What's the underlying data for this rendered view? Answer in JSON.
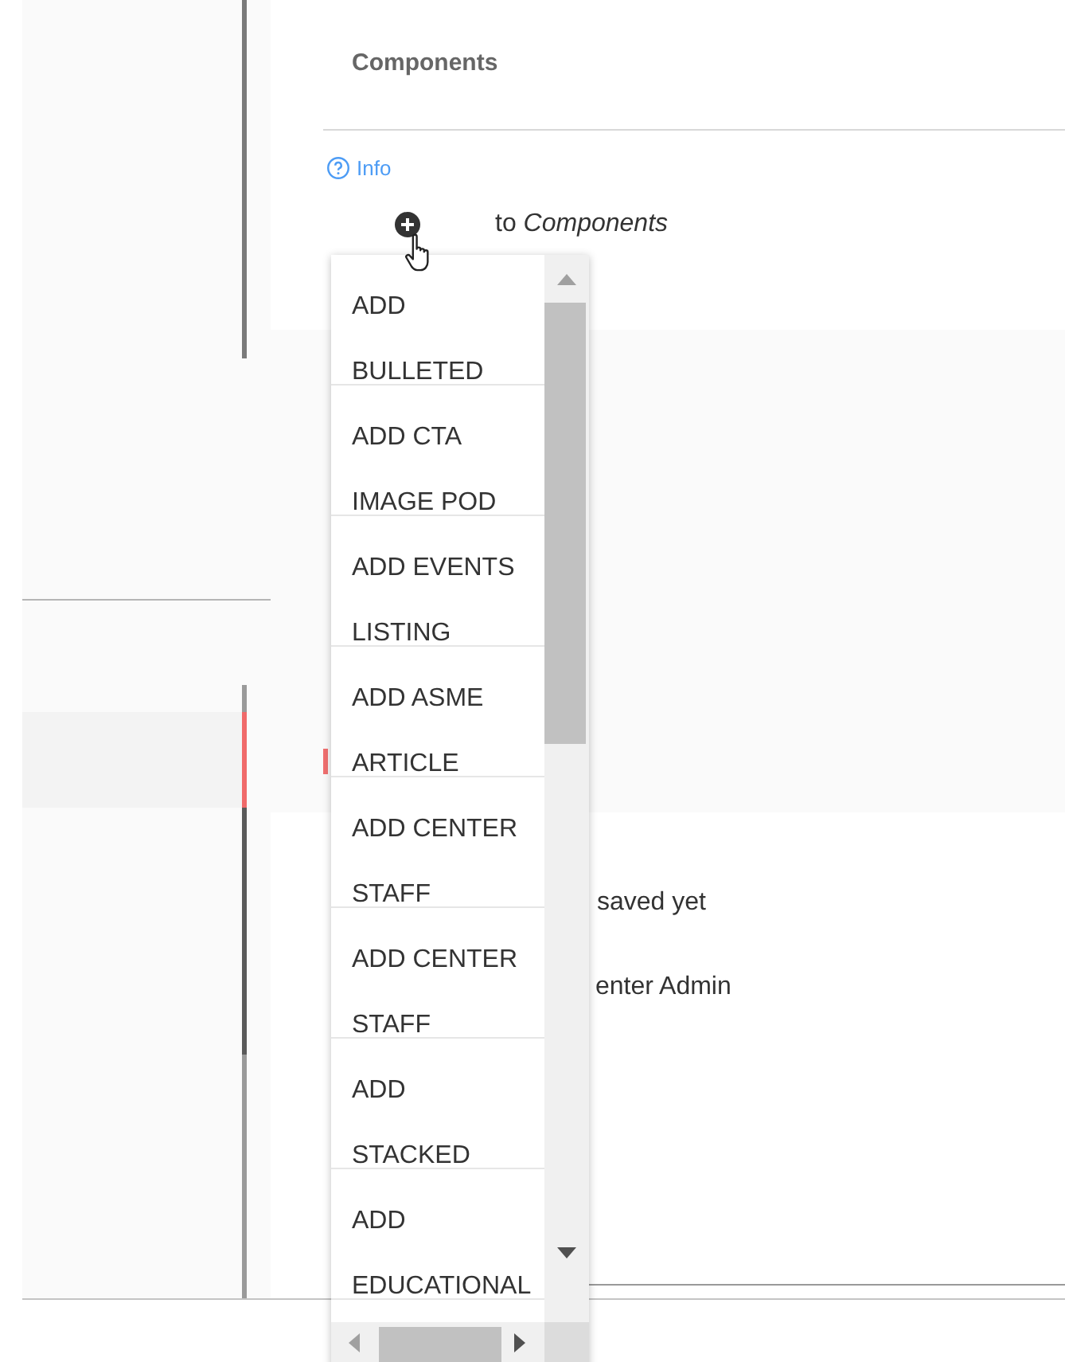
{
  "panel": {
    "title": "Components",
    "info_link": "Info",
    "add_hint": "to *Components*"
  },
  "status_lines": [
    "saved yet",
    "enter Admin"
  ],
  "dropdown": {
    "items": [
      {
        "lines": [
          "ADD",
          "BULLETED"
        ]
      },
      {
        "lines": [
          "ADD CTA",
          "IMAGE POD"
        ]
      },
      {
        "lines": [
          "ADD EVENTS",
          "LISTING"
        ]
      },
      {
        "lines": [
          "ADD ASME",
          "ARTICLE"
        ]
      },
      {
        "lines": [
          "ADD CENTER",
          "STAFF"
        ]
      },
      {
        "lines": [
          "ADD CENTER",
          "STAFF"
        ]
      },
      {
        "lines": [
          "ADD",
          "STACKED"
        ]
      },
      {
        "lines": [
          "ADD",
          "EDUCATIONAL"
        ]
      }
    ]
  }
}
